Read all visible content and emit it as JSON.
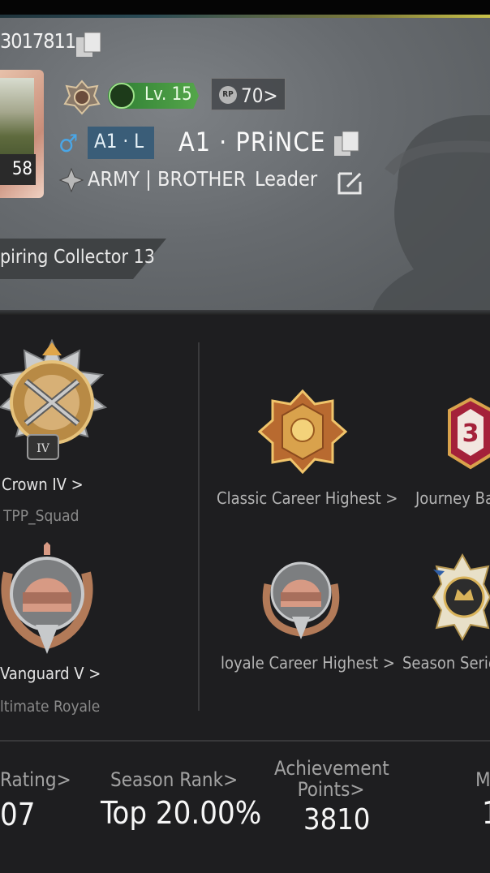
{
  "header": {
    "player_id": "3017811",
    "level_label": "Lv. 15",
    "rp_label": "70>",
    "rp_icon_text": "RP",
    "clan_tag": "A1 · L",
    "player_name": "A1 · PRiNCE",
    "avatar_level": "58",
    "crew_name": "ARMY | BROTHER",
    "crew_role": "Leader",
    "title_banner": "piring Collector 13"
  },
  "medals": {
    "classic": {
      "tier": "Crown IV >",
      "mode": "TPP_Squad",
      "emblem_numeral": "IV"
    },
    "ultimate": {
      "tier": "Vanguard V >",
      "mode": "ltimate Royale"
    }
  },
  "career": [
    {
      "label": "Classic Career Highest >"
    },
    {
      "label": "Journey Ba",
      "badge_number": "3"
    },
    {
      "label": "loyale Career Highest >"
    },
    {
      "label": "Season Serie"
    }
  ],
  "stats": [
    {
      "label": "Rating>",
      "value": "07"
    },
    {
      "label": "Season Rank>",
      "value": "Top 20.00%"
    },
    {
      "label_line1": "Achievement",
      "label_line2": "Points>",
      "value": "3810"
    },
    {
      "label": "M",
      "value": "1"
    }
  ],
  "colors": {
    "level_green": "#4f9f45",
    "clan_blue": "#3a5d78",
    "gender_blue": "#4aa6e6",
    "journey_red": "#a4213a",
    "gold": "#d8a24a"
  }
}
